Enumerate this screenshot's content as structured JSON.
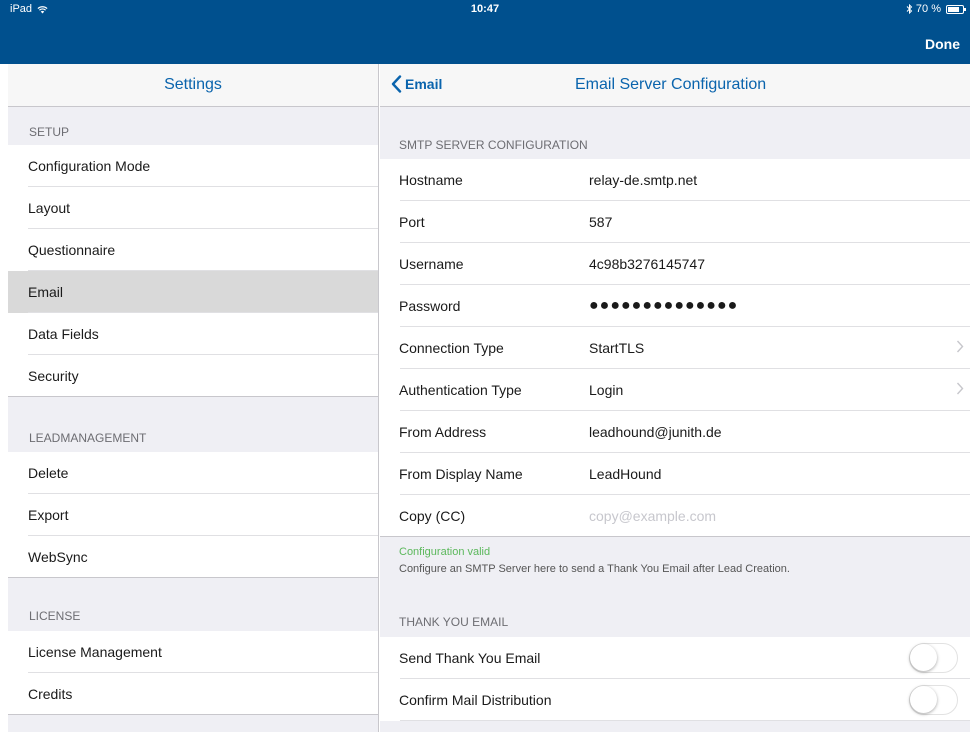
{
  "status_bar": {
    "device": "iPad",
    "time": "10:47",
    "battery": "70 %"
  },
  "nav": {
    "done_label": "Done"
  },
  "settings": {
    "title": "Settings",
    "sections": [
      {
        "title": "SETUP",
        "items": [
          "Configuration Mode",
          "Layout",
          "Questionnaire",
          "Email",
          "Data Fields",
          "Security"
        ],
        "selected": "Email"
      },
      {
        "title": "LEADMANAGEMENT",
        "items": [
          "Delete",
          "Export",
          "WebSync"
        ]
      },
      {
        "title": "LICENSE",
        "items": [
          "License Management",
          "Credits"
        ]
      }
    ]
  },
  "detail": {
    "back_label": "Email",
    "title": "Email Server Configuration",
    "smtp_section_title": "SMTP SERVER CONFIGURATION",
    "fields": [
      {
        "label": "Hostname",
        "value": "relay-de.smtp.net"
      },
      {
        "label": "Port",
        "value": "587"
      },
      {
        "label": "Username",
        "value": "4c98b3276145747"
      },
      {
        "label": "Password",
        "value": "●●●●●●●●●●●●●●"
      },
      {
        "label": "Connection Type",
        "value": "StartTLS"
      },
      {
        "label": "Authentication Type",
        "value": "Login"
      },
      {
        "label": "From Address",
        "value": "leadhound@junith.de"
      },
      {
        "label": "From Display Name",
        "value": "LeadHound"
      },
      {
        "label": "Copy (CC)",
        "placeholder": "copy@example.com"
      }
    ],
    "status_text": "Configuration valid",
    "hint_text": "Configure an SMTP Server here to send a Thank You Email after Lead Creation.",
    "thank_you_section_title": "THANK YOU EMAIL",
    "toggles": [
      {
        "label": "Send Thank You Email",
        "on": false
      },
      {
        "label": "Confirm Mail Distribution",
        "on": false
      }
    ]
  }
}
